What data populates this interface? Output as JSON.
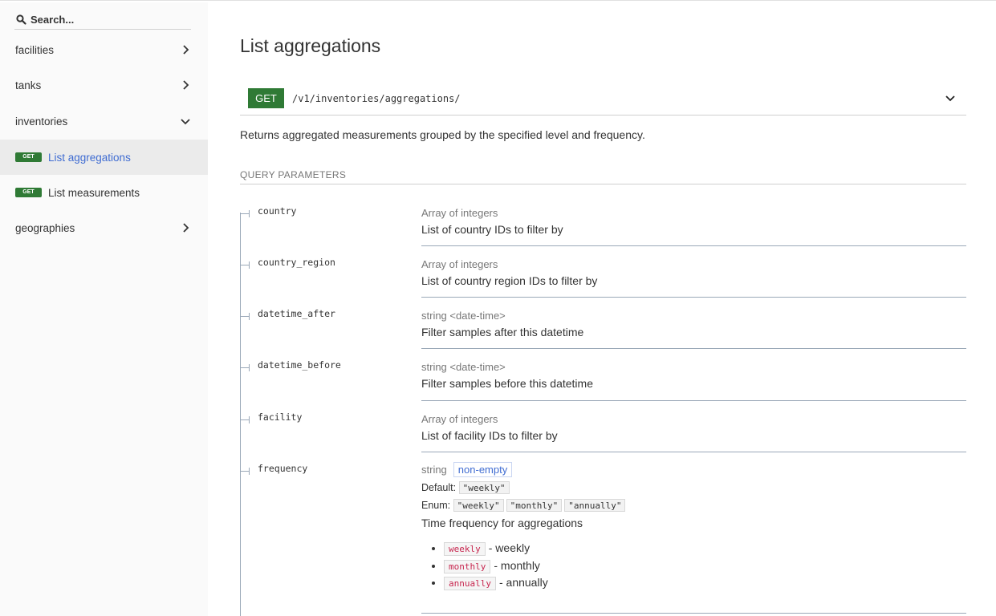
{
  "sidebar": {
    "search_placeholder": "Search...",
    "items": [
      {
        "label": "facilities",
        "icon": "chevron-right-icon"
      },
      {
        "label": "tanks",
        "icon": "chevron-right-icon"
      },
      {
        "label": "inventories",
        "icon": "chevron-down-icon"
      },
      {
        "label": "List aggregations",
        "method": "GET",
        "active": true
      },
      {
        "label": "List measurements",
        "method": "GET"
      },
      {
        "label": "geographies",
        "icon": "chevron-right-icon"
      }
    ]
  },
  "main": {
    "title": "List aggregations",
    "method": "GET",
    "path": "/v1/inventories/aggregations/",
    "description": "Returns aggregated measurements grouped by the specified level and frequency.",
    "query_params_label": "QUERY PARAMETERS",
    "params": [
      {
        "name": "country",
        "type": "Array of integers",
        "description": "List of country IDs to filter by"
      },
      {
        "name": "country_region",
        "type": "Array of integers",
        "description": "List of country region IDs to filter by"
      },
      {
        "name": "datetime_after",
        "type": "string <date-time>",
        "description": "Filter samples after this datetime"
      },
      {
        "name": "datetime_before",
        "type": "string <date-time>",
        "description": "Filter samples before this datetime"
      },
      {
        "name": "facility",
        "type": "Array of integers",
        "description": "List of facility IDs to filter by"
      },
      {
        "name": "frequency",
        "type": "string",
        "constraint": "non-empty",
        "default_label": "Default:",
        "default_value": "\"weekly\"",
        "enum_label": "Enum:",
        "enum_values": [
          "\"weekly\"",
          "\"monthly\"",
          "\"annually\""
        ],
        "description": "Time frequency for aggregations",
        "options": [
          {
            "code": "weekly",
            "text": "- weekly"
          },
          {
            "code": "monthly",
            "text": "- monthly"
          },
          {
            "code": "annually",
            "text": "- annually"
          }
        ]
      }
    ]
  },
  "colors": {
    "get_badge": "#2f7a35",
    "active_link": "#3f6cd2",
    "sidebar_bg": "#fafafa",
    "active_bg": "#ebebeb",
    "code_text": "#c7254e"
  }
}
